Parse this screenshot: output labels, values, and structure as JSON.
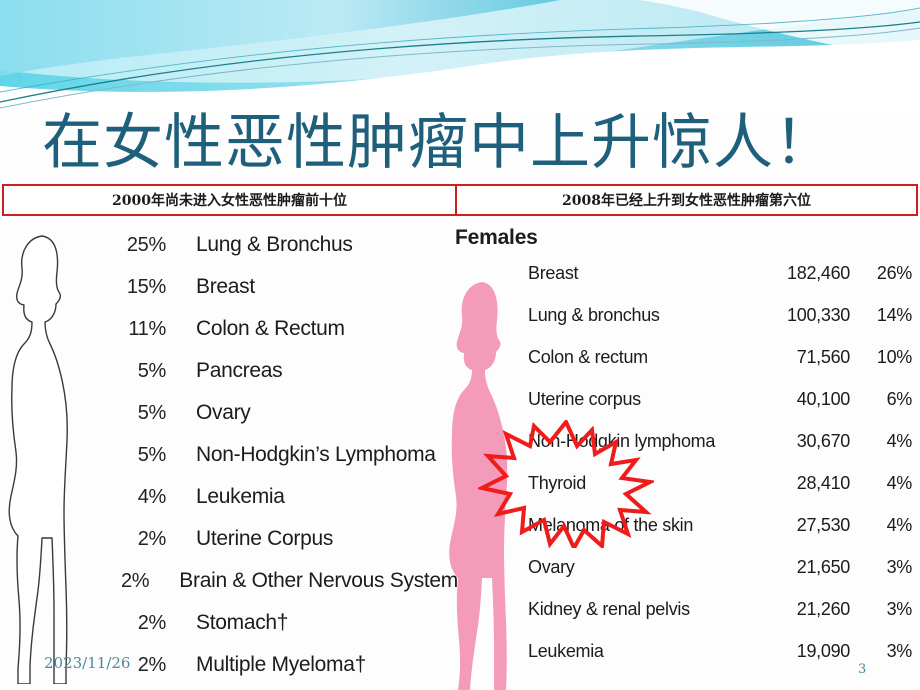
{
  "slide": {
    "title": "在女性恶性肿瘤中上升惊人！",
    "title_color": "#1e5f7c",
    "accent_red": "#cc1f1f",
    "banner_color": "#66d3e4",
    "pink_color": "#f39bb8",
    "date": "2023/11/26",
    "page_number": "3"
  },
  "captions": {
    "left": "2000年尚未进入女性恶性肿瘤前十位",
    "right": "2008年已经上升到女性恶性肿瘤第六位"
  },
  "left_panel": {
    "figure_icon": "female-silhouette-outline-icon",
    "rows": [
      {
        "pct": "25%",
        "name": "Lung & Bronchus"
      },
      {
        "pct": "15%",
        "name": "Breast"
      },
      {
        "pct": "11%",
        "name": "Colon & Rectum"
      },
      {
        "pct": "5%",
        "name": "Pancreas"
      },
      {
        "pct": "5%",
        "name": "Ovary"
      },
      {
        "pct": "5%",
        "name": "Non-Hodgkin’s Lymphoma"
      },
      {
        "pct": "4%",
        "name": "Leukemia"
      },
      {
        "pct": "2%",
        "name": "Uterine Corpus"
      },
      {
        "pct": "2%",
        "name": "Brain & Other Nervous System"
      },
      {
        "pct": "2%",
        "name": "Stomach†"
      },
      {
        "pct": "2%",
        "name": "Multiple Myeloma†"
      }
    ]
  },
  "right_panel": {
    "heading": "Females",
    "figure_icon": "female-silhouette-pink-icon",
    "highlight_icon": "red-starburst-icon",
    "highlight_target": "Thyroid",
    "rows": [
      {
        "name": "Breast",
        "count": "182,460",
        "pct": "26%"
      },
      {
        "name": "Lung & bronchus",
        "count": "100,330",
        "pct": "14%"
      },
      {
        "name": "Colon & rectum",
        "count": "71,560",
        "pct": "10%"
      },
      {
        "name": "Uterine corpus",
        "count": "40,100",
        "pct": "6%"
      },
      {
        "name": "Non-Hodgkin lymphoma",
        "count": "30,670",
        "pct": "4%"
      },
      {
        "name": "Thyroid",
        "count": "28,410",
        "pct": "4%"
      },
      {
        "name": "Melanoma of the skin",
        "count": "27,530",
        "pct": "4%"
      },
      {
        "name": "Ovary",
        "count": "21,650",
        "pct": "3%"
      },
      {
        "name": "Kidney & renal pelvis",
        "count": "21,260",
        "pct": "3%"
      },
      {
        "name": "Leukemia",
        "count": "19,090",
        "pct": "3%"
      }
    ]
  }
}
